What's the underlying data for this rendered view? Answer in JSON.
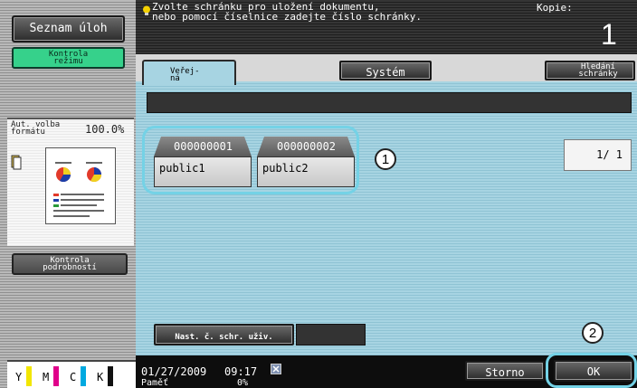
{
  "sidebar": {
    "job_list_label": "Seznam úloh",
    "check_mode_label": "Kontrola\nrežimu",
    "auto_format_label": "Aut. volba\nformátu",
    "zoom_value": "100.0%",
    "check_details_label": "Kontrola\npodrobností",
    "toner_labels": [
      "Y",
      "M",
      "C",
      "K"
    ]
  },
  "header": {
    "message": "Zvolte schránku pro uložení dokumentu,\nnebo pomocí číselnice zadejte číslo schránky.",
    "copies_label": "Kopie:",
    "copies_value": "1"
  },
  "tabs": {
    "public_label": "Veřej-\nná",
    "system_label": "Systém",
    "search_label": "Hledání\nschránky"
  },
  "boxes": [
    {
      "number": "000000001",
      "name": "public1"
    },
    {
      "number": "000000002",
      "name": "public2"
    }
  ],
  "pager": {
    "text": "1/ 1"
  },
  "callouts": [
    "1",
    "2"
  ],
  "user_box_label": "Nast. č. schr. uživ.",
  "footer": {
    "date": "01/27/2009",
    "time": "09:17",
    "memory_label": "Paměť",
    "memory_value": "0%",
    "cancel_label": "Storno",
    "ok_label": "OK"
  },
  "colors": {
    "green_button": "#36d18b",
    "callout": "#74d2e6",
    "panel": "#a7d4e2"
  }
}
